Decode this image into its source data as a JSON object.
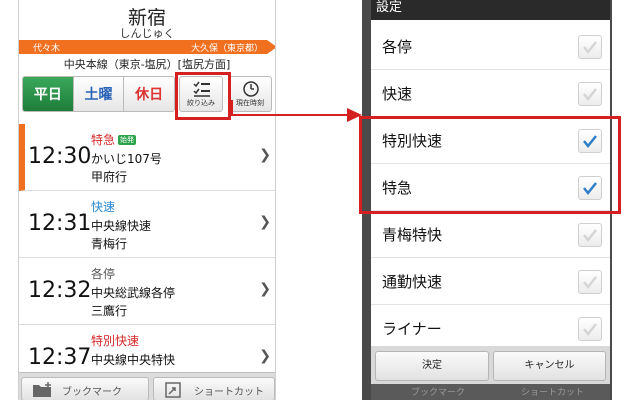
{
  "station": {
    "name": "新宿",
    "reading": "しんじゅく",
    "prev": "代々木",
    "next": "大久保（東京都）",
    "line": "中央本線（東京-塩尻）[塩尻方面]"
  },
  "day_tabs": [
    {
      "label": "平日",
      "selected": true
    },
    {
      "label": "土曜",
      "selected": false
    },
    {
      "label": "休日",
      "selected": false
    }
  ],
  "toolbar": {
    "filter_label": "絞り込み",
    "clock_label": "現在時刻"
  },
  "departures": [
    {
      "kind": "特急",
      "kind_color": "#d62828",
      "badge": "始発",
      "time": "12:30",
      "train": "かいじ107号",
      "dest": "甲府行"
    },
    {
      "kind": "快速",
      "kind_color": "#2a8ad4",
      "badge": "",
      "time": "12:31",
      "train": "中央線快速",
      "dest": "青梅行"
    },
    {
      "kind": "各停",
      "kind_color": "#555555",
      "badge": "",
      "time": "12:32",
      "train": "中央総武線各停",
      "dest": "三鷹行"
    },
    {
      "kind": "特別快速",
      "kind_color": "#d62828",
      "badge": "",
      "time": "12:37",
      "train": "中央線中央特快",
      "dest": ""
    }
  ],
  "bottom": {
    "bookmark_label": "ブックマーク",
    "shortcut_label": "ショートカット"
  },
  "dialog": {
    "title": "設定",
    "behind_title": "新宿",
    "options": [
      {
        "label": "各停",
        "checked": false
      },
      {
        "label": "快速",
        "checked": false
      },
      {
        "label": "特別快速",
        "checked": true
      },
      {
        "label": "特急",
        "checked": true
      },
      {
        "label": "青梅特快",
        "checked": false
      },
      {
        "label": "通勤快速",
        "checked": false
      },
      {
        "label": "ライナー",
        "checked": false
      }
    ],
    "ok_label": "決定",
    "cancel_label": "キャンセル",
    "behind_bottom_left": "ブックマーク",
    "behind_bottom_right": "ショートカット"
  },
  "colors": {
    "accent_orange": "#f07020",
    "highlight_red": "#d42020",
    "check_blue": "#2f7fc8",
    "weekday_green": "#1e7d3a"
  }
}
